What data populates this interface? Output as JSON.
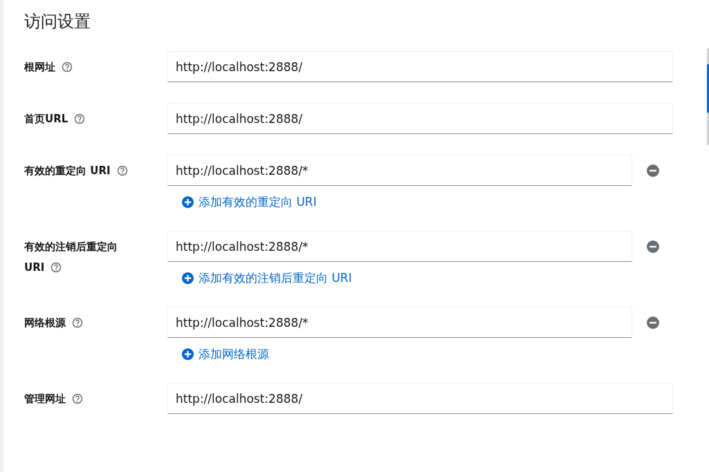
{
  "section": {
    "title": "访问设置"
  },
  "fields": [
    {
      "kind": "single",
      "label": "根网址",
      "values": [
        "http://localhost:2888/"
      ]
    },
    {
      "kind": "single",
      "label": "首页URL",
      "values": [
        "http://localhost:2888/"
      ]
    },
    {
      "kind": "multi",
      "label": "有效的重定向 URI",
      "values": [
        "http://localhost:2888/*"
      ],
      "add_link": "添加有效的重定向 URI"
    },
    {
      "kind": "multi",
      "label": "有效的注销后重定向 URI",
      "values": [
        "http://localhost:2888/*"
      ],
      "add_link": "添加有效的注销后重定向 URI"
    },
    {
      "kind": "multi",
      "label": "网络根源",
      "values": [
        "http://localhost:2888/*"
      ],
      "add_link": "添加网络根源"
    },
    {
      "kind": "single",
      "label": "管理网址",
      "values": [
        "http://localhost:2888/"
      ]
    }
  ]
}
